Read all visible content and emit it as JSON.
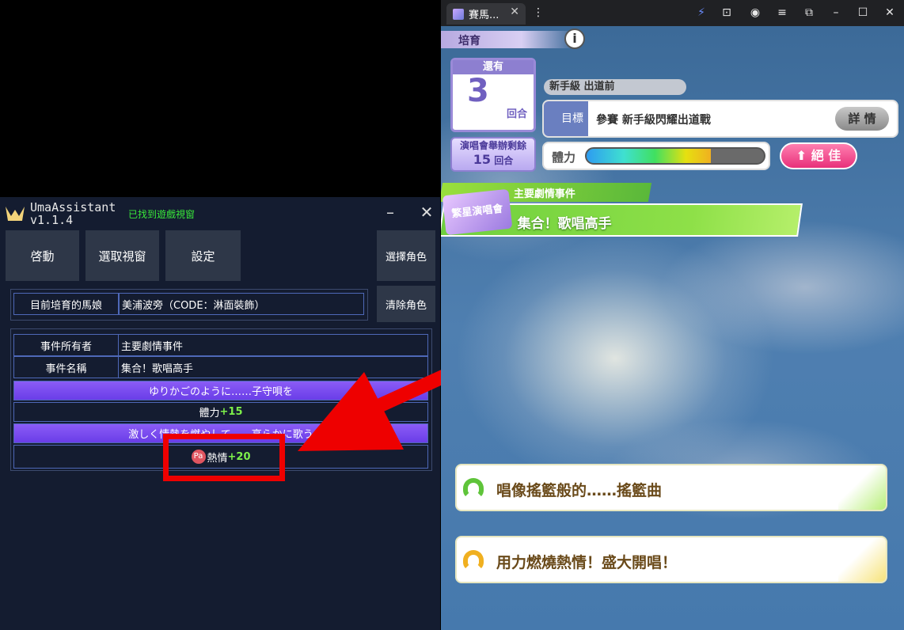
{
  "assistant": {
    "app_name_line1": "UmaAssistant",
    "app_name_line2": "v1.1.4",
    "status": "已找到遊戲視窗",
    "minimize_icon": "minus-icon",
    "close_icon": "close-icon",
    "buttons": {
      "start": "啓動",
      "select_window": "選取視窗",
      "settings": "設定",
      "select_character": "選擇角色",
      "clear_character": "清除角色"
    },
    "current_label": "目前培育的馬娘",
    "current_value": "美浦波旁（CODE：淋面裝飾）",
    "event_owner_label": "事件所有者",
    "event_owner_value": "主要劇情事件",
    "event_name_label": "事件名稱",
    "event_name_value": "集合！歌唱高手",
    "choices": [
      {
        "title": "ゆりかごのように……子守唄を",
        "effect_stat": "體力",
        "effect_value": "+15",
        "icon_text": ""
      },
      {
        "title": "激しく情熱を燃やして……高らかに歌う",
        "effect_stat": "熱情",
        "effect_value": "+20",
        "icon_text": "Pa"
      }
    ],
    "accent_color": "#7b4bf0",
    "annotation_color": "#ee0000"
  },
  "game": {
    "tab_title": "賽馬...",
    "header": "培育",
    "turns_header": "還有",
    "turns_left": "3",
    "turns_unit": "回合",
    "concert_label": "演唱會舉辦剩餘",
    "concert_turns": "15",
    "concert_unit": "回合",
    "rank": "新手級 出道前",
    "goal_tag": "目標",
    "goal_text": "參賽 新手級閃耀出道戰",
    "details_button": "詳 情",
    "hp_label": "體力",
    "hp_fraction": 0.7,
    "mood": "絕 佳",
    "event_type": "主要劇情事件",
    "event_logo": "繁星演唱會",
    "event_title": "集合！歌唱高手",
    "options": [
      {
        "text": "唱像搖籃般的……搖籃曲",
        "color": "#5fc43a"
      },
      {
        "text": "用力燃燒熱情！盛大開唱！",
        "color": "#f0b020"
      }
    ]
  }
}
